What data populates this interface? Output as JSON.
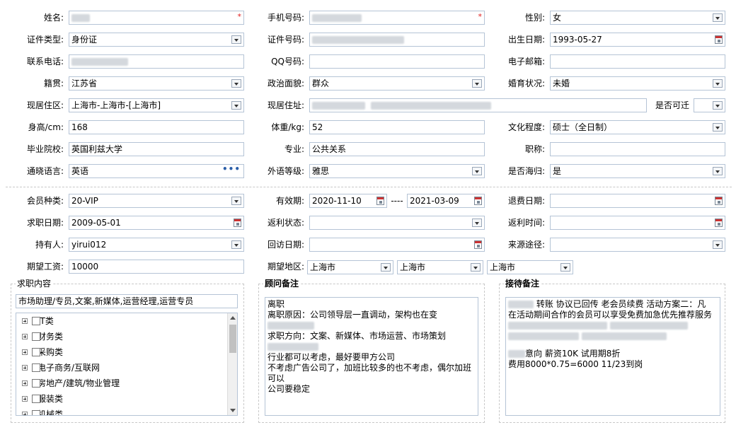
{
  "row1": {
    "name_label": "姓名:",
    "required_mark": "*",
    "phone_label": "手机号码:",
    "gender_label": "性别:",
    "gender_value": "女"
  },
  "row2": {
    "id_type_label": "证件类型:",
    "id_type_value": "身份证",
    "id_no_label": "证件号码:",
    "birth_label": "出生日期:",
    "birth_value": "1993-05-27"
  },
  "row3": {
    "contact_label": "联系电话:",
    "qq_label": "QQ号码:",
    "email_label": "电子邮箱:"
  },
  "row4": {
    "native_label": "籍贯:",
    "native_value": "江苏省",
    "political_label": "政治面貌:",
    "political_value": "群众",
    "marital_label": "婚育状况:",
    "marital_value": "未婚"
  },
  "row5": {
    "region_label": "现居住区:",
    "region_value": "上海市-上海市-[上海市]",
    "address_label": "现居住址:",
    "movable_label": "是否可迁"
  },
  "row6": {
    "height_label": "身高/cm:",
    "height_value": "168",
    "weight_label": "体重/kg:",
    "weight_value": "52",
    "edu_label": "文化程度:",
    "edu_value": "硕士（全日制）"
  },
  "row7": {
    "school_label": "毕业院校:",
    "school_value": "英国利兹大学",
    "major_label": "专业:",
    "major_value": "公共关系",
    "title_label": "职称:"
  },
  "row8": {
    "lang_label": "通晓语言:",
    "lang_value": "英语",
    "lang_more": "•••",
    "lang_level_label": "外语等级:",
    "lang_level_value": "雅思",
    "returnee_label": "是否海归:",
    "returnee_value": "是"
  },
  "row9": {
    "member_label": "会员种类:",
    "member_value": "20-VIP",
    "valid_label": "有效期:",
    "valid_from": "2020-11-10",
    "valid_sep": "----",
    "valid_to": "2021-03-09",
    "refund_label": "退费日期:"
  },
  "row10": {
    "job_date_label": "求职日期:",
    "job_date_value": "2009-05-01",
    "rebate_status_label": "返利状态:",
    "rebate_time_label": "返利时间:"
  },
  "row11": {
    "holder_label": "持有人:",
    "holder_value": "yirui012",
    "visit_label": "回访日期:",
    "source_label": "来源途径:"
  },
  "row12": {
    "salary_label": "期望工资:",
    "salary_value": "10000",
    "area_label": "期望地区:",
    "area1": "上海市",
    "area2": "上海市",
    "area3": "上海市"
  },
  "job_panel": {
    "title": "求职内容",
    "summary": "市场助理/专员,文案,新媒体,运营经理,运营专员",
    "tree": [
      "IT类",
      "财务类",
      "采购类",
      "电子商务/互联网",
      "房地产/建筑/物业管理",
      "服装类",
      "机械类"
    ]
  },
  "advisor_panel": {
    "title": "顾问备注",
    "lines": [
      "离职",
      "离职原因：公司领导层一直调动，架构也在变",
      "",
      "求职方向：文案、新媒体、市场运营、市场策划",
      "",
      "行业都可以考虑，最好要甲方公司",
      "不考虑广告公司了，加班比较多的也不考虑，偶尔加班",
      "可以",
      "公司要稳定"
    ]
  },
  "reception_panel": {
    "title": "接待备注",
    "line1": "转账  协议已回传  老会员续费  活动方案二：凡",
    "line2": "在活动期间合作的会员可以享受免费加急优先推荐服务",
    "line3": "意向  薪资10K  试用期8折",
    "line4": "费用8000*0.75=6000   11/23到岗"
  }
}
